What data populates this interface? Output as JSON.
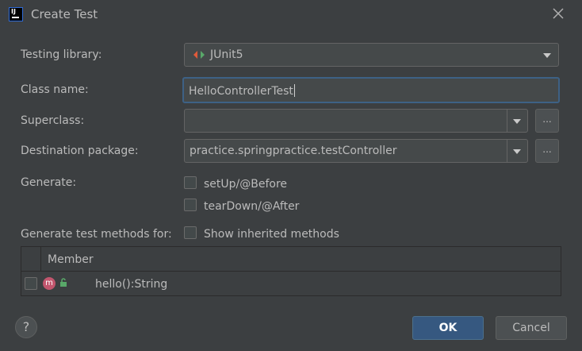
{
  "dialog": {
    "title": "Create Test",
    "app_icon_text": "IJ"
  },
  "form": {
    "testing_library_label": "Testing library:",
    "testing_library_value": "JUnit5",
    "class_name_label": "Class name:",
    "class_name_value": "HelloControllerTest",
    "superclass_label": "Superclass:",
    "superclass_value": "",
    "superclass_browse": "...",
    "destination_label": "Destination package:",
    "destination_value": "practice.springpractice.testController",
    "destination_browse": "...",
    "generate_label": "Generate:",
    "setup_label": "setUp/@Before",
    "setup_checked": false,
    "teardown_label": "tearDown/@After",
    "teardown_checked": false,
    "generate_methods_label": "Generate test methods for:",
    "show_inherited_label": "Show inherited methods",
    "show_inherited_checked": false
  },
  "table": {
    "header_member": "Member",
    "rows": [
      {
        "checked": false,
        "badge": "m",
        "member": "hello():String"
      }
    ]
  },
  "buttons": {
    "ok": "OK",
    "cancel": "Cancel",
    "help": "?"
  },
  "colors": {
    "background": "#3c3f41",
    "field": "#45494a",
    "focus_border": "#3d6185",
    "ok_button": "#365880",
    "method_badge": "#c2566e",
    "junit_green": "#59a869",
    "junit_red": "#e05a3a"
  }
}
